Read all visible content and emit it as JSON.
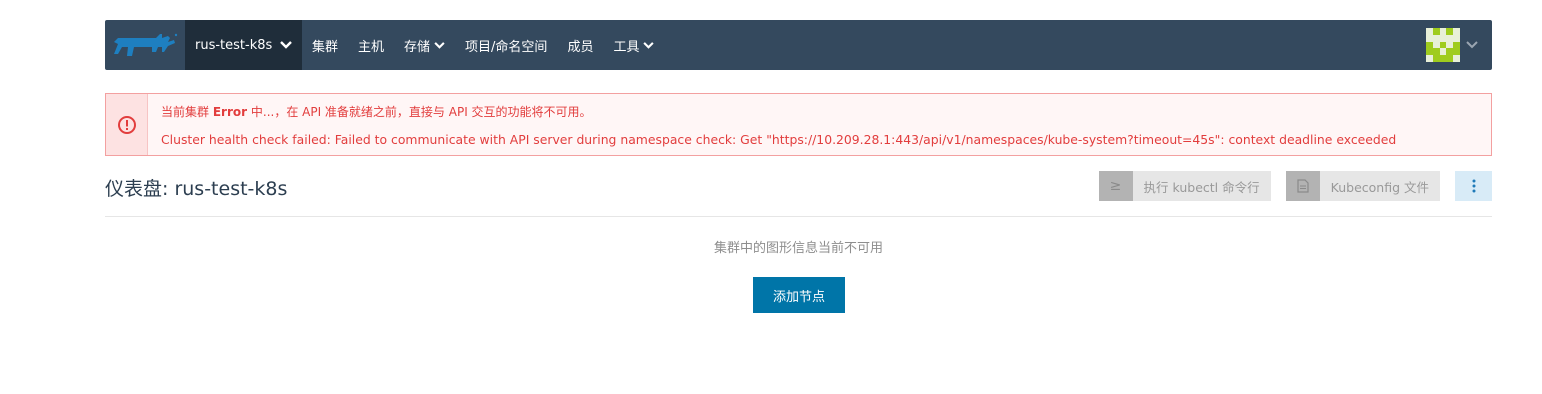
{
  "header": {
    "cluster_name": "rus-test-k8s",
    "nav": [
      {
        "label": "集群",
        "dropdown": false
      },
      {
        "label": "主机",
        "dropdown": false
      },
      {
        "label": "存储",
        "dropdown": true
      },
      {
        "label": "项目/命名空间",
        "dropdown": false
      },
      {
        "label": "成员",
        "dropdown": false
      },
      {
        "label": "工具",
        "dropdown": true
      }
    ]
  },
  "alert": {
    "prefix": "当前集群",
    "state": "Error",
    "suffix": "中...，在 API 准备就绪之前，直接与 API 交互的功能将不可用。",
    "detail": "Cluster health check failed: Failed to communicate with API server during namespace check: Get \"https://10.209.28.1:443/api/v1/namespaces/kube-system?timeout=45s\": context deadline exceeded"
  },
  "page": {
    "title": "仪表盘: rus-test-k8s",
    "kubectl_icon": "≥",
    "kubectl_label": "执行 kubectl 命令行",
    "kubeconfig_label": "Kubeconfig 文件",
    "empty_message": "集群中的图形信息当前不可用",
    "add_node_label": "添加节点"
  },
  "colors": {
    "topbar": "#34495e",
    "cluster_selector": "#1f2d3a",
    "error": "#e23d3d",
    "primary_button": "#0075a8"
  },
  "icons": {
    "logo": "rancher-cow-logo",
    "alert": "exclamation-circle-icon",
    "kubectl": "terminal-icon",
    "kubeconfig": "file-icon",
    "more": "vertical-ellipsis-icon"
  }
}
